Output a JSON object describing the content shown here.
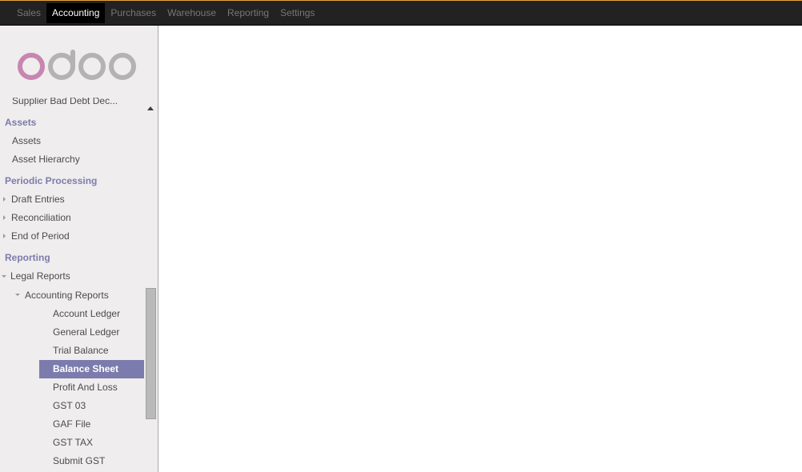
{
  "topbar": {
    "menu": [
      {
        "label": "Sales",
        "active": false
      },
      {
        "label": "Accounting",
        "active": true
      },
      {
        "label": "Purchases",
        "active": false
      },
      {
        "label": "Warehouse",
        "active": false
      },
      {
        "label": "Reporting",
        "active": false
      },
      {
        "label": "Settings",
        "active": false
      }
    ],
    "accent_color": "#e8a33b"
  },
  "logo": {
    "text": "odoo",
    "colors": {
      "first_o": "#c786b0",
      "rest": "#b3b3b3"
    }
  },
  "sidebar": {
    "partial_item": "Supplier Bad Debt Dec...",
    "sections": [
      {
        "title": "Assets",
        "items": [
          {
            "label": "Assets"
          },
          {
            "label": "Asset Hierarchy"
          }
        ]
      },
      {
        "title": "Periodic Processing",
        "items": [
          {
            "label": "Draft Entries",
            "collapsed": true
          },
          {
            "label": "Reconciliation",
            "collapsed": true
          },
          {
            "label": "End of Period",
            "collapsed": true
          }
        ]
      },
      {
        "title": "Reporting",
        "items": [
          {
            "label": "Legal Reports",
            "expanded": true
          },
          {
            "label": "Accounting Reports",
            "expanded": true
          },
          {
            "label": "Account Ledger"
          },
          {
            "label": "General Ledger"
          },
          {
            "label": "Trial Balance"
          },
          {
            "label": "Balance Sheet",
            "selected": true
          },
          {
            "label": "Profit And Loss"
          },
          {
            "label": "GST 03"
          },
          {
            "label": "GAF File"
          },
          {
            "label": "GST TAX"
          },
          {
            "label": "Submit GST"
          }
        ]
      }
    ],
    "selected_color": "#7c7bad",
    "section_color": "#7c7bad"
  }
}
